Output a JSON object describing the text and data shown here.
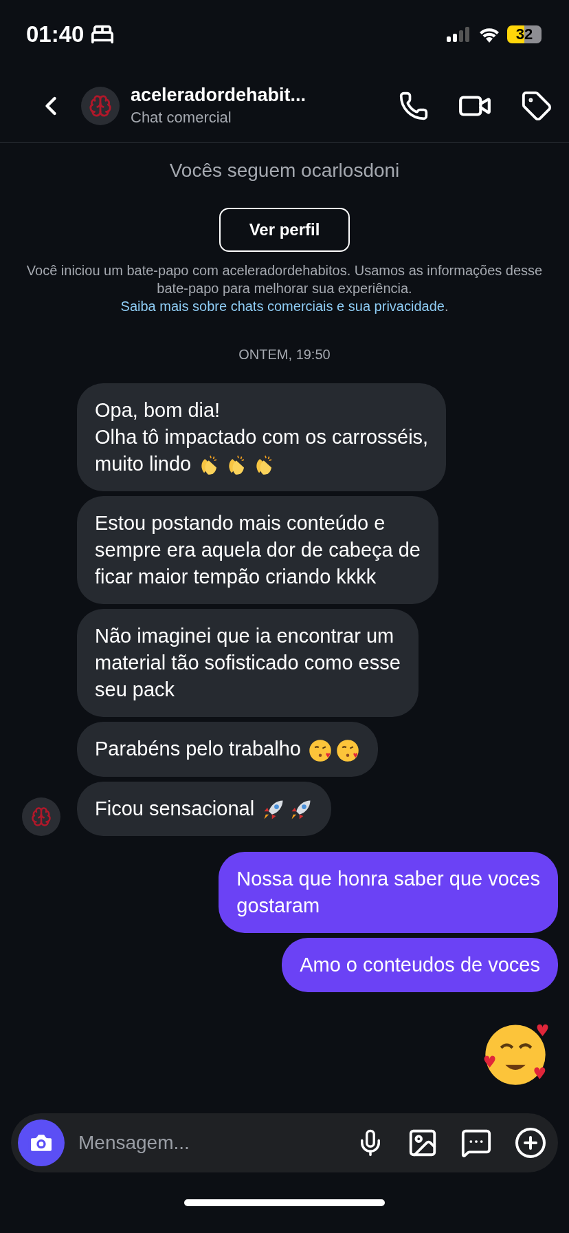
{
  "status_bar": {
    "time": "01:40",
    "battery": "32"
  },
  "header": {
    "name": "aceleradordehabit...",
    "subtitle": "Chat comercial"
  },
  "profile_info": {
    "following": "Vocês seguem ocarlosdoni",
    "button": "Ver perfil",
    "notice": "Você iniciou um bate-papo com aceleradordehabitos. Usamos as informações desse bate-papo para melhorar sua experiência.",
    "notice_link": "Saiba mais sobre chats comerciais e sua privacidade",
    "notice_end": "."
  },
  "timestamp": "ONTEM, 19:50",
  "messages": [
    {
      "kind": "text",
      "incoming": true,
      "lines": [
        "Opa, bom dia!",
        "Olha tô impactado com os carrosséis,",
        "muito lindo"
      ],
      "emojis": [
        {
          "kind": "clap"
        },
        {
          "kind": "clap"
        },
        {
          "kind": "clap"
        }
      ]
    },
    {
      "kind": "text",
      "incoming": true,
      "lines": [
        "Estou postando mais conteúdo e",
        "sempre era aquela dor de cabeça de",
        "ficar maior tempão criando kkkk"
      ]
    },
    {
      "kind": "text",
      "incoming": true,
      "lines": [
        "Não imaginei que ia encontrar um",
        "material tão sofisticado como esse",
        "seu pack"
      ]
    },
    {
      "kind": "text",
      "incoming": true,
      "lines": [
        "Parabéns pelo trabalho"
      ],
      "emojis": [
        {
          "kind": "kiss"
        },
        {
          "kind": "kiss"
        }
      ]
    },
    {
      "kind": "text",
      "incoming": true,
      "lines": [
        "Ficou sensacional"
      ],
      "emojis": [
        {
          "kind": "rocket"
        },
        {
          "kind": "rocket"
        }
      ],
      "avatar": true
    },
    {
      "kind": "text",
      "incoming": false,
      "lines": [
        "Nossa que honra saber que voces",
        "gostaram"
      ]
    },
    {
      "kind": "text",
      "incoming": false,
      "lines": [
        "Amo o conteudos de voces"
      ]
    },
    {
      "kind": "emoji",
      "incoming": false,
      "emoji": {
        "kind": "hearts"
      }
    }
  ],
  "composer": {
    "placeholder": "Mensagem..."
  }
}
